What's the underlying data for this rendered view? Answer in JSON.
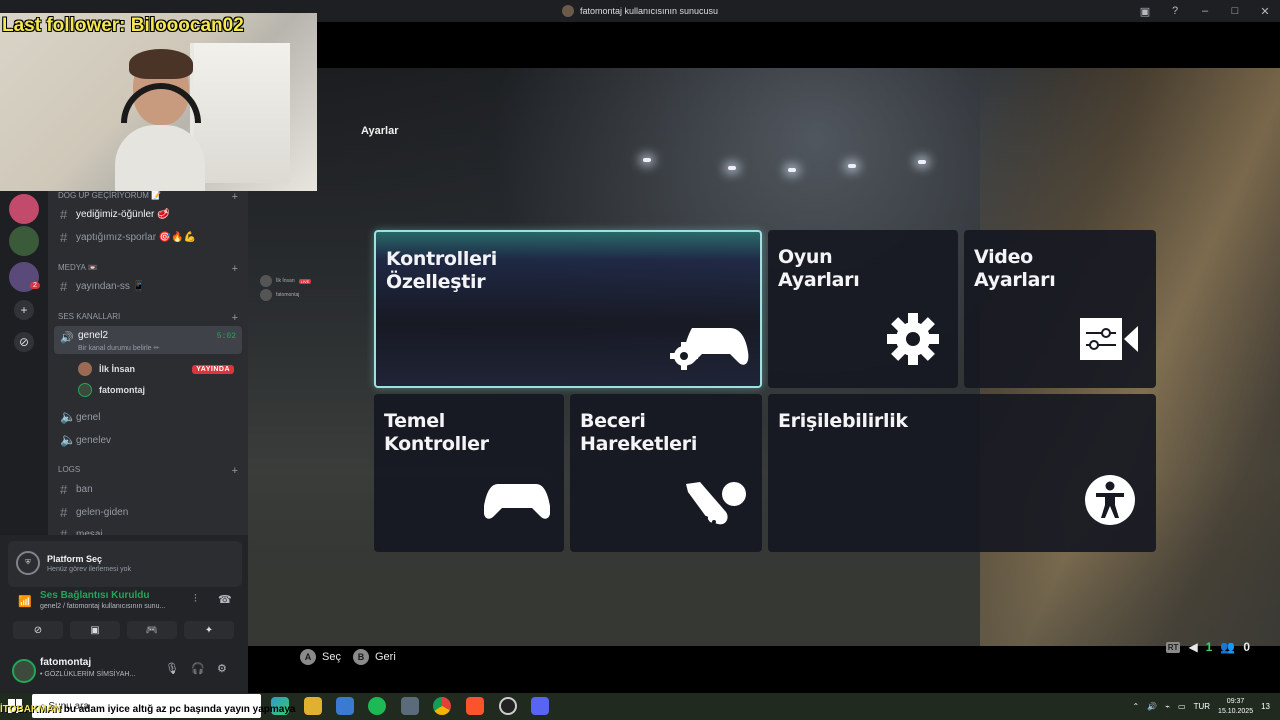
{
  "window": {
    "title": "fatomontaj kullanıcısının sunucusu",
    "controls": [
      "▣",
      "?",
      "–",
      "□",
      "✕"
    ]
  },
  "webcam": {
    "follower_text": "Last follower: Bilooocan02"
  },
  "channels": {
    "categories": [
      {
        "name": "DOG UP GEÇİRİYORUM 📝",
        "plus": "+"
      },
      {
        "name": "MEDYA 📼",
        "plus": "+"
      },
      {
        "name": "Ses Kanalları",
        "plus": "+"
      },
      {
        "name": "LOGS",
        "plus": "+"
      }
    ],
    "text_channels": [
      {
        "label": "yediğimiz-öğünler 🥩"
      },
      {
        "label": "yaptığımız-sporlar 🎯🔥💪"
      },
      {
        "label": "yayından-ss 📱"
      },
      {
        "label": "genel"
      },
      {
        "label": "genelev"
      },
      {
        "label": "ban"
      },
      {
        "label": "gelen-giden"
      },
      {
        "label": "mesai"
      }
    ],
    "active_voice": {
      "name": "genel2",
      "status": "Bir kanal durumu belirle ✏",
      "timer": "5:02"
    },
    "voice_users": [
      {
        "name": "İlk İnsan",
        "badge": "YAYINDA"
      },
      {
        "name": "fatomontaj"
      }
    ],
    "rail_badge": "2"
  },
  "panel": {
    "task_title": "Platform Seç",
    "task_subtitle": "Henüz görev ilerlemesi yok",
    "connection_title": "Ses Bağlantısı Kuruldu",
    "connection_subtitle": "genel2 / fatomontaj kullanıcısının sunu...",
    "username": "fatomontaj",
    "user_status": "• GÖZLÜKLERİM SİMSİYAH..."
  },
  "game": {
    "title": "Ayarlar",
    "tiles": [
      {
        "label": "Kontrolleri\nÖzelleştir",
        "icon": "gamepad-gear-icon",
        "selected": true
      },
      {
        "label": "Oyun\nAyarları",
        "icon": "gear-icon"
      },
      {
        "label": "Video\nAyarları",
        "icon": "video-settings-icon"
      },
      {
        "label": "Temel\nKontroller",
        "icon": "gamepad-icon"
      },
      {
        "label": "Beceri\nHareketleri",
        "icon": "boot-ball-icon"
      },
      {
        "label": "Erişilebilirlik",
        "icon": "accessibility-icon"
      }
    ],
    "prompts": [
      {
        "key": "A",
        "label": "Seç"
      },
      {
        "key": "B",
        "label": "Geri"
      }
    ],
    "hud": {
      "rt": "RT",
      "count1": "1",
      "count2": "0"
    },
    "mini_users": [
      {
        "name": "İlk İnsan",
        "badge": "LIVE"
      },
      {
        "name": "fatomontaj"
      }
    ]
  },
  "taskbar": {
    "search_placeholder": "Sunu ara",
    "ticker_highlight": "İTOBAKMAN",
    "ticker_text": "bu adam iyice altığ az pc başında yayın yapmaya",
    "language": "TUR",
    "time": "09:37",
    "date": "15.10.2025",
    "notif": "13"
  },
  "colors": {
    "accent_green": "#23a55a",
    "live_red": "#da373c",
    "selected_border": "#9fe0e0",
    "follower_yellow": "#f5e84a"
  }
}
